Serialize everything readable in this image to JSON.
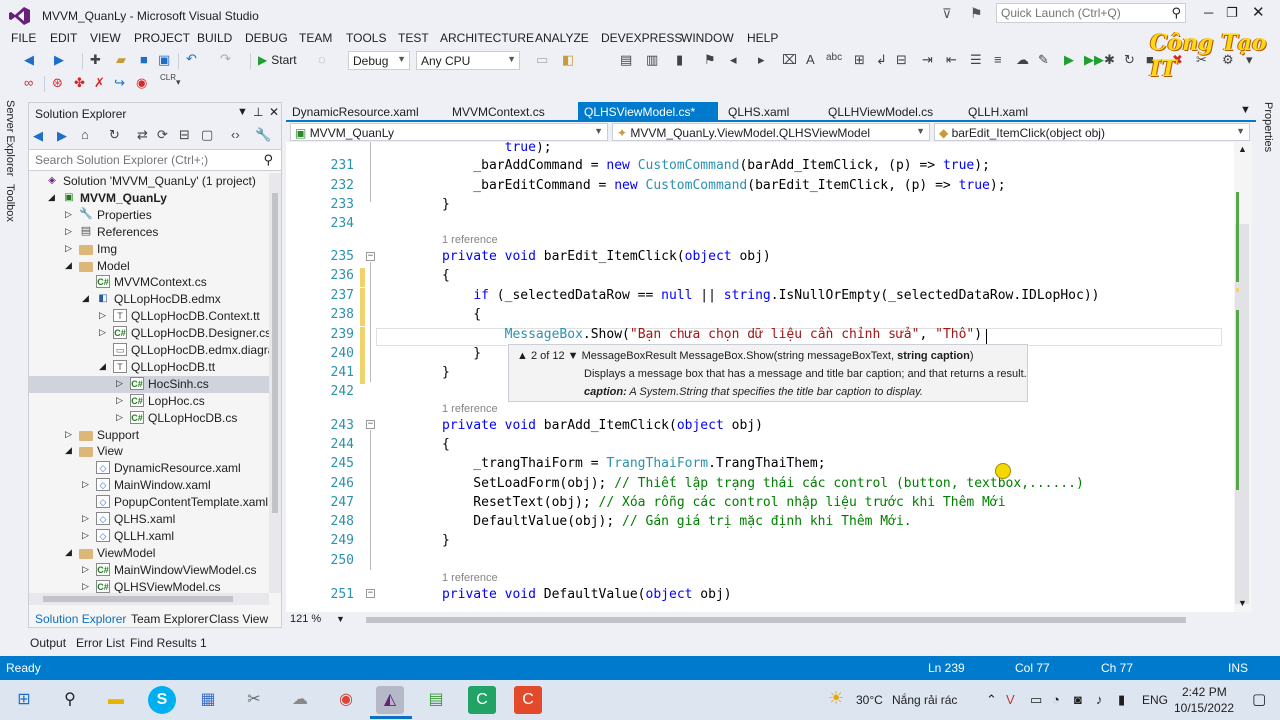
{
  "window": {
    "title": "MVVM_QuanLy - Microsoft Visual Studio",
    "quick_launch_placeholder": "Quick Launch (Ctrl+Q)"
  },
  "brand": "Công Tạo IT",
  "menu": [
    "FILE",
    "EDIT",
    "VIEW",
    "PROJECT",
    "BUILD",
    "DEBUG",
    "TEAM",
    "TOOLS",
    "TEST",
    "ARCHITECTURE",
    "ANALYZE",
    "DEVEXPRESS",
    "WINDOW",
    "HELP"
  ],
  "toolbar": {
    "start_label": "Start",
    "configuration": "Debug",
    "platform": "Any CPU"
  },
  "side_tabs": [
    "Server Explorer",
    "Toolbox"
  ],
  "right_tab": "Properties",
  "solution_explorer": {
    "title": "Solution Explorer",
    "search_placeholder": "Search Solution Explorer (Ctrl+;)",
    "tree": [
      {
        "label": "Solution 'MVVM_QuanLy' (1 project)",
        "level": 0,
        "icon": "solution-icon",
        "expander": "none"
      },
      {
        "label": "MVVM_QuanLy",
        "level": 1,
        "icon": "project-icon",
        "expander": "open",
        "bold": true
      },
      {
        "label": "Properties",
        "level": 2,
        "icon": "wrench-icon",
        "expander": "closed"
      },
      {
        "label": "References",
        "level": 2,
        "icon": "references-icon",
        "expander": "closed"
      },
      {
        "label": "Img",
        "level": 2,
        "icon": "folder-icon",
        "expander": "closed"
      },
      {
        "label": "Model",
        "level": 2,
        "icon": "folder-icon",
        "expander": "open"
      },
      {
        "label": "MVVMContext.cs",
        "level": 3,
        "icon": "csharp-file-icon",
        "expander": "none"
      },
      {
        "label": "QLLopHocDB.edmx",
        "level": 3,
        "icon": "edmx-icon",
        "expander": "open"
      },
      {
        "label": "QLLopHocDB.Context.tt",
        "level": 4,
        "icon": "tt-file-icon",
        "expander": "closed"
      },
      {
        "label": "QLLopHocDB.Designer.cs",
        "level": 4,
        "icon": "csharp-file-icon",
        "expander": "closed"
      },
      {
        "label": "QLLopHocDB.edmx.diagram",
        "level": 4,
        "icon": "diagram-file-icon",
        "expander": "none"
      },
      {
        "label": "QLLopHocDB.tt",
        "level": 4,
        "icon": "tt-file-icon",
        "expander": "open"
      },
      {
        "label": "HocSinh.cs",
        "level": 5,
        "icon": "csharp-file-icon",
        "expander": "closed",
        "selected": true
      },
      {
        "label": "LopHoc.cs",
        "level": 5,
        "icon": "csharp-file-icon",
        "expander": "closed"
      },
      {
        "label": "QLLopHocDB.cs",
        "level": 5,
        "icon": "csharp-file-icon",
        "expander": "closed"
      },
      {
        "label": "Support",
        "level": 2,
        "icon": "folder-icon",
        "expander": "closed"
      },
      {
        "label": "View",
        "level": 2,
        "icon": "folder-icon",
        "expander": "open"
      },
      {
        "label": "DynamicResource.xaml",
        "level": 3,
        "icon": "xaml-file-icon",
        "expander": "none"
      },
      {
        "label": "MainWindow.xaml",
        "level": 3,
        "icon": "xaml-file-icon",
        "expander": "closed"
      },
      {
        "label": "PopupContentTemplate.xaml",
        "level": 3,
        "icon": "xaml-file-icon",
        "expander": "none"
      },
      {
        "label": "QLHS.xaml",
        "level": 3,
        "icon": "xaml-file-icon",
        "expander": "closed"
      },
      {
        "label": "QLLH.xaml",
        "level": 3,
        "icon": "xaml-file-icon",
        "expander": "closed"
      },
      {
        "label": "ViewModel",
        "level": 2,
        "icon": "folder-icon",
        "expander": "open"
      },
      {
        "label": "MainWindowViewModel.cs",
        "level": 3,
        "icon": "csharp-file-icon",
        "expander": "closed"
      },
      {
        "label": "QLHSViewModel.cs",
        "level": 3,
        "icon": "csharp-file-icon",
        "expander": "closed"
      }
    ],
    "bottom_tabs": [
      "Solution Explorer",
      "Team Explorer",
      "Class View"
    ]
  },
  "output_tabs": [
    "Output",
    "Error List",
    "Find Results 1"
  ],
  "doc_tabs": [
    {
      "label": "DynamicResource.xaml",
      "active": false
    },
    {
      "label": "MVVMContext.cs",
      "active": false
    },
    {
      "label": "QLHSViewModel.cs*",
      "active": true
    },
    {
      "label": "QLHS.xaml",
      "active": false
    },
    {
      "label": "QLLHViewModel.cs",
      "active": false
    },
    {
      "label": "QLLH.xaml",
      "active": false
    }
  ],
  "navbar": {
    "project": "MVVM_QuanLy",
    "class": "MVVM_QuanLy.ViewModel.QLHSViewModel",
    "member": "barEdit_ItemClick(object obj)"
  },
  "editor": {
    "refs": [
      "1 reference",
      "1 reference",
      "1 reference"
    ],
    "lines": [
      {
        "n": "",
        "html": "        <span class='k'>true</span>);"
      },
      {
        "n": "231",
        "html": "    _barAddCommand = <span class='k'>new</span> <span class='t'>CustomCommand</span>(barAdd_ItemClick, (p) =&gt; <span class='k'>true</span>);"
      },
      {
        "n": "232",
        "html": "    _barEditCommand = <span class='k'>new</span> <span class='t'>CustomCommand</span>(barEdit_ItemClick, (p) =&gt; <span class='k'>true</span>);"
      },
      {
        "n": "233",
        "html": "}"
      },
      {
        "n": "234",
        "html": ""
      },
      {
        "n": "235",
        "html": "<span class='k'>private</span> <span class='k'>void</span> barEdit_ItemClick(<span class='k'>object</span> obj)"
      },
      {
        "n": "236",
        "html": "{"
      },
      {
        "n": "237",
        "html": "    <span class='k'>if</span> (_selectedDataRow == <span class='k'>null</span> || <span class='k'>string</span>.IsNullOrEmpty(_selectedDataRow.IDLopHoc))"
      },
      {
        "n": "238",
        "html": "    {"
      },
      {
        "n": "239",
        "html": "        <span class='t'>MessageBox</span>.Show(<span class='s'>\"Bạn chưa chọn dữ liệu cần chỉnh sửa\"</span>, <span class='s'>\"Thô\"</span>)"
      },
      {
        "n": "240",
        "html": "    }"
      },
      {
        "n": "241",
        "html": "}"
      },
      {
        "n": "242",
        "html": ""
      },
      {
        "n": "243",
        "html": "<span class='k'>private</span> <span class='k'>void</span> barAdd_ItemClick(<span class='k'>object</span> obj)"
      },
      {
        "n": "244",
        "html": "{"
      },
      {
        "n": "245",
        "html": "    _trangThaiForm = <span class='t'>TrangThaiForm</span>.TrangThaiThem;"
      },
      {
        "n": "246",
        "html": "    SetLoadForm(obj); <span class='c'>// Thiết lập trạng thái các control (button, textbox,......)</span>"
      },
      {
        "n": "247",
        "html": "    ResetText(obj); <span class='c'>// Xóa rỗng các control nhập liệu trước khi Thêm Mới</span>"
      },
      {
        "n": "248",
        "html": "    DefaultValue(obj); <span class='c'>// Gán giá trị mặc định khi Thêm Mới.</span>"
      },
      {
        "n": "249",
        "html": "}"
      },
      {
        "n": "250",
        "html": ""
      },
      {
        "n": "251",
        "html": "<span class='k'>private</span> <span class='k'>void</span> DefaultValue(<span class='k'>object</span> obj)"
      }
    ]
  },
  "tooltip": {
    "counter": "2 of 12",
    "signature_prefix": "MessageBoxResult MessageBox.Show(string messageBoxText, ",
    "signature_bold": "string caption",
    "signature_suffix": ")",
    "description": "Displays a message box that has a message and title bar caption; and that returns a result.",
    "param_name": "caption:",
    "param_desc": " A System.String that specifies the title bar caption to display."
  },
  "zoom": "121 %",
  "status": {
    "ready": "Ready",
    "ln": "Ln 239",
    "col": "Col 77",
    "ch": "Ch 77",
    "mode": "INS"
  },
  "taskbar": {
    "weather_temp": "30°C",
    "weather_desc": "Nắng rải rác",
    "lang": "ENG",
    "time": "2:42 PM",
    "date": "10/15/2022"
  },
  "colors": {
    "accent": "#007acc",
    "keyword": "#0000ff",
    "type": "#2b91af",
    "string": "#a31515",
    "comment": "#008000"
  }
}
